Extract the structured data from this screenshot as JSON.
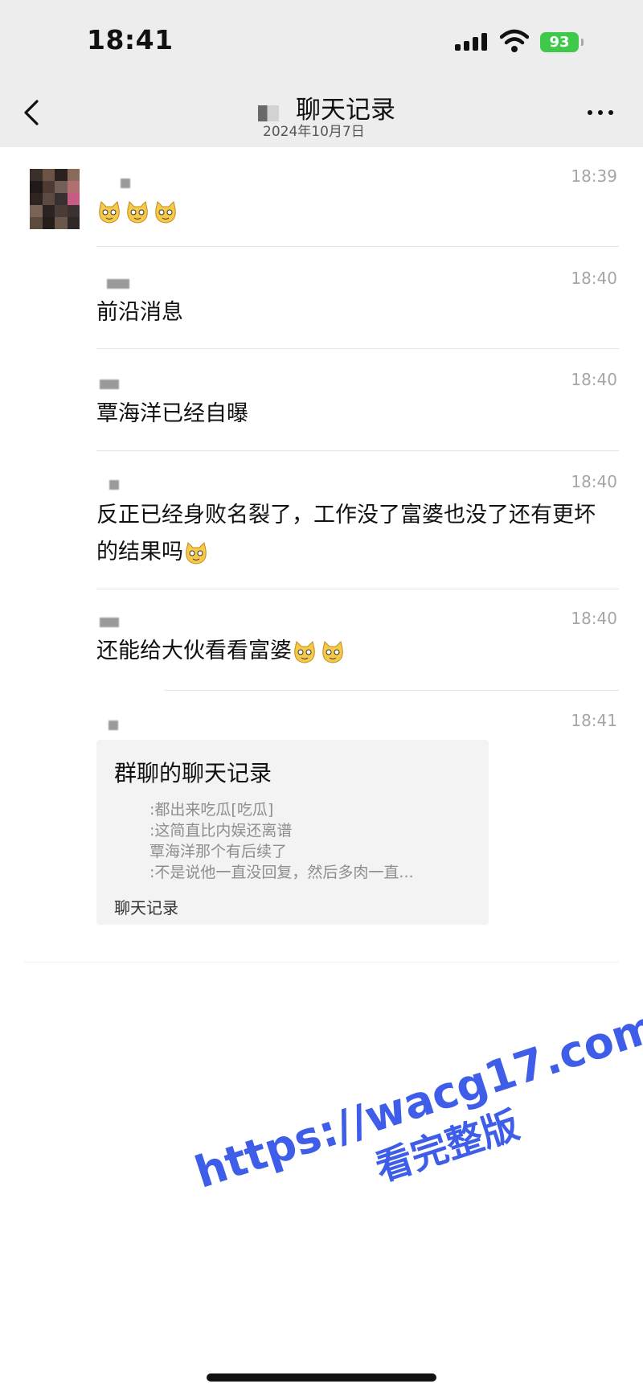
{
  "status_bar": {
    "time": "18:41",
    "battery": "93"
  },
  "header": {
    "title": "聊天记录",
    "subtitle": "2024年10月7日"
  },
  "messages": [
    {
      "time": "18:39",
      "text": ""
    },
    {
      "time": "18:40",
      "text": "前沿消息"
    },
    {
      "time": "18:40",
      "text": "覃海洋已经自曝"
    },
    {
      "time": "18:40",
      "text": "反正已经身败名裂了，工作没了富婆也没了还有更坏的结果吗"
    },
    {
      "time": "18:40",
      "text": "还能给大伙看看富婆"
    },
    {
      "time": "18:41",
      "text": ""
    }
  ],
  "card": {
    "title": "群聊的聊天记录",
    "lines": [
      ":都出来吃瓜[吃瓜]",
      ":这简直比内娱还离谱",
      "覃海洋那个有后续了",
      ":不是说他一直没回复，然后多肉一直..."
    ],
    "footer": "聊天记录"
  },
  "watermark": {
    "line1": "https://wacg17.com",
    "line2": "看完整版"
  },
  "icons": [
    "back-arrow-icon",
    "more-dots-icon",
    "signal-icon",
    "wifi-icon",
    "cat-emoji-icon"
  ]
}
